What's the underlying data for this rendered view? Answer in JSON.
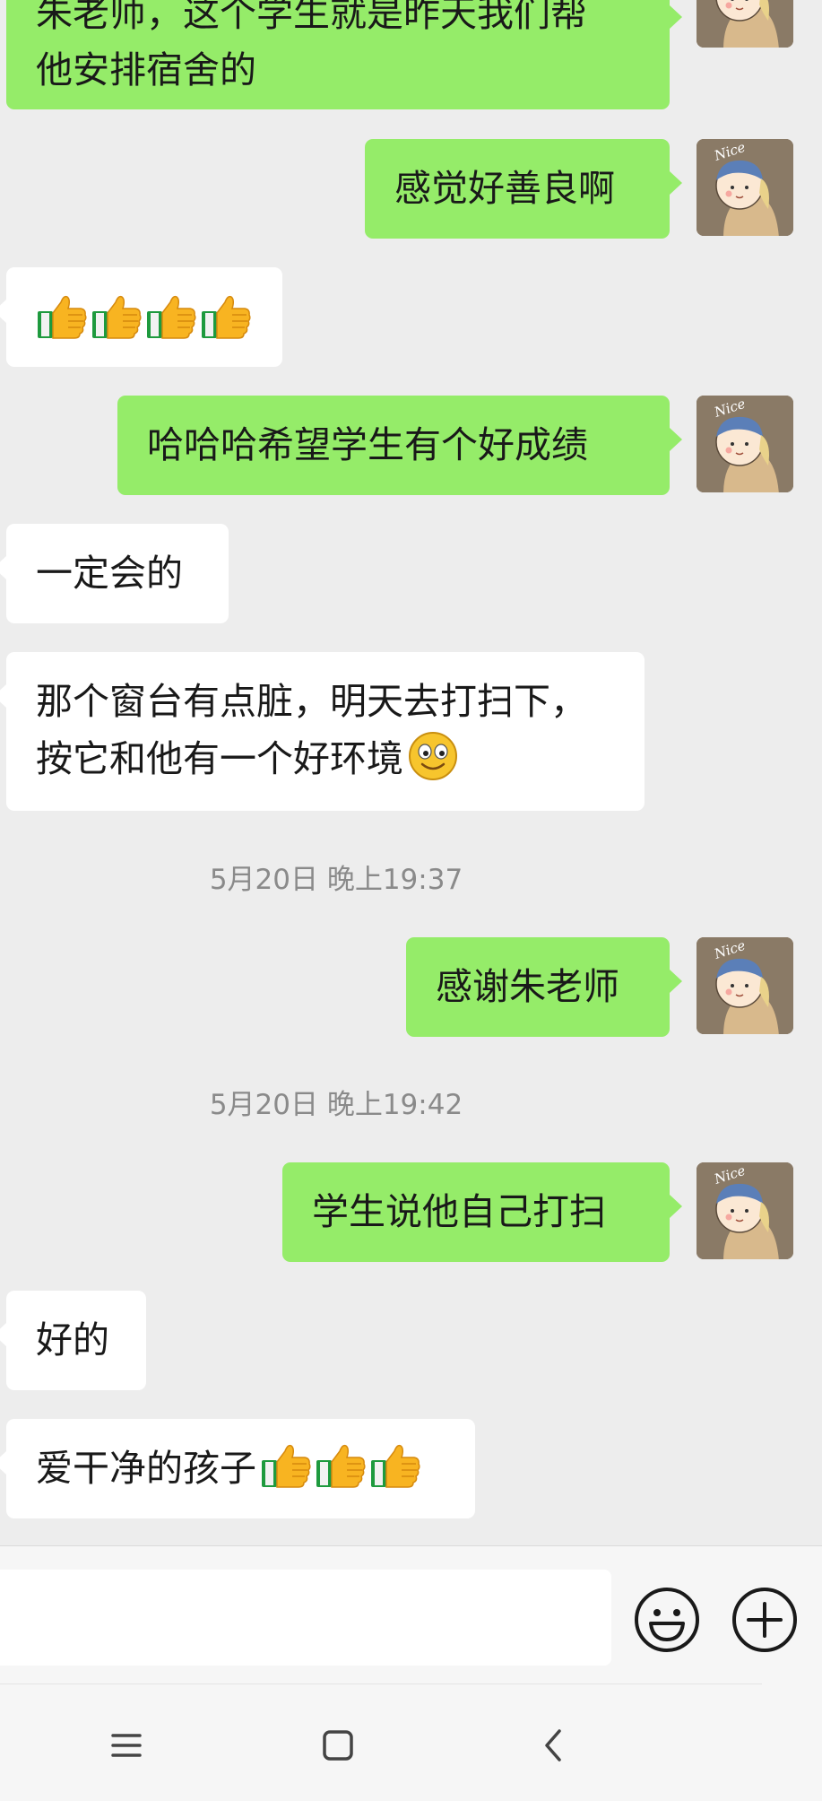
{
  "messages": [
    {
      "text_line1": "朱老师，这个学生就是昨天我们帮",
      "text_line2": "他安排宿舍的"
    },
    {
      "text": "感觉好善良啊"
    },
    {
      "icons": [
        "thumbs-up-icon",
        "thumbs-up-icon",
        "thumbs-up-icon",
        "thumbs-up-icon"
      ]
    },
    {
      "text": "哈哈哈希望学生有个好成绩"
    },
    {
      "text": "一定会的"
    },
    {
      "text_line1": "那个窗台有点脏，明天去打扫下，",
      "text_line2": "按它和他有一个好环境",
      "icon": "smiley-icon"
    },
    {
      "text": "感谢朱老师"
    },
    {
      "text": "学生说他自己打扫"
    },
    {
      "text": "好的"
    },
    {
      "text": "爱干净的孩子",
      "icons": [
        "thumbs-up-icon",
        "thumbs-up-icon",
        "thumbs-up-icon"
      ]
    }
  ],
  "timestamps": [
    "5月20日 晚上19:37",
    "5月20日 晚上19:42"
  ],
  "avatar": {
    "label": "Nice"
  },
  "input_bar": {
    "value": "",
    "icons": [
      "emoji-icon",
      "plus-icon"
    ]
  },
  "nav_bar": {
    "icons": [
      "menu-icon",
      "home-icon",
      "back-icon"
    ]
  },
  "colors": {
    "sent_bubble": "#95ec69",
    "received_bubble": "#ffffff",
    "background": "#ededed"
  }
}
